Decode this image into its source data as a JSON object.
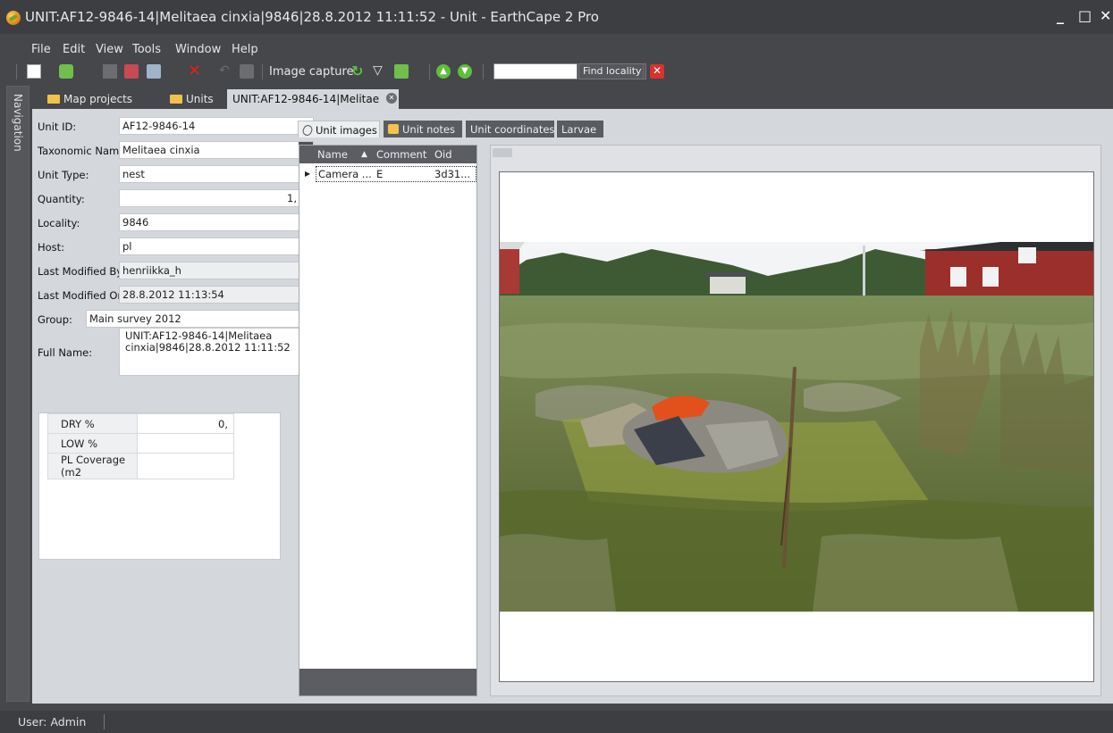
{
  "window": {
    "title": "UNIT:AF12-9846-14|Melitaea cinxia|9846|28.8.2012 11:11:52 - Unit - EarthCape 2 Pro",
    "minimize": "_",
    "maximize": "□",
    "close": "✕"
  },
  "menu": [
    "File",
    "Edit",
    "View",
    "Tools",
    "Window",
    "Help"
  ],
  "toolbar": {
    "image_capture": "Image capture",
    "find_locality_value": "",
    "find_locality_button": "Find locality"
  },
  "navigation": {
    "label": "Navigation"
  },
  "doc_tabs": [
    {
      "label": "Map projects"
    },
    {
      "label": "Units"
    },
    {
      "label": "UNIT:AF12-9846-14|Melitae"
    }
  ],
  "form": {
    "unit_id": {
      "label": "Unit ID:",
      "value": "AF12-9846-14"
    },
    "taxonomic_name": {
      "label": "Taxonomic Name:",
      "value": "Melitaea cinxia"
    },
    "unit_type": {
      "label": "Unit Type:",
      "value": "nest"
    },
    "quantity": {
      "label": "Quantity:",
      "value": "1,"
    },
    "locality": {
      "label": "Locality:",
      "value": "9846"
    },
    "host": {
      "label": "Host:",
      "value": "pl"
    },
    "last_modified_by": {
      "label": "Last Modified By:",
      "value": "henriikka_h"
    },
    "last_modified_on": {
      "label": "Last Modified On:",
      "value": "28.8.2012 11:13:54"
    },
    "group": {
      "label": "Group:",
      "value": "Main survey 2012"
    },
    "full_name": {
      "label": "Full Name:",
      "value": "UNIT:AF12-9846-14|Melitaea cinxia|9846|28.8.2012 11:11:52"
    }
  },
  "measures": [
    {
      "key": "DRY %",
      "value": "0,"
    },
    {
      "key": "LOW %",
      "value": ""
    },
    {
      "key": "PL Coverage (m2",
      "value": ""
    }
  ],
  "sub_tabs": [
    {
      "label": "Unit images"
    },
    {
      "label": "Unit notes"
    },
    {
      "label": "Unit coordinates"
    },
    {
      "label": "Larvae"
    }
  ],
  "grid": {
    "columns": [
      "Name",
      "Comment",
      "Oid"
    ],
    "rows": [
      {
        "name": "Camera ...",
        "comment": "E",
        "oid": "3d31..."
      }
    ]
  },
  "status": {
    "user": "User: Admin"
  },
  "colors": {
    "chrome": "#3c3e42",
    "panel": "#d4d7db",
    "close_red": "#d9312b",
    "folder": "#f2c14a"
  }
}
